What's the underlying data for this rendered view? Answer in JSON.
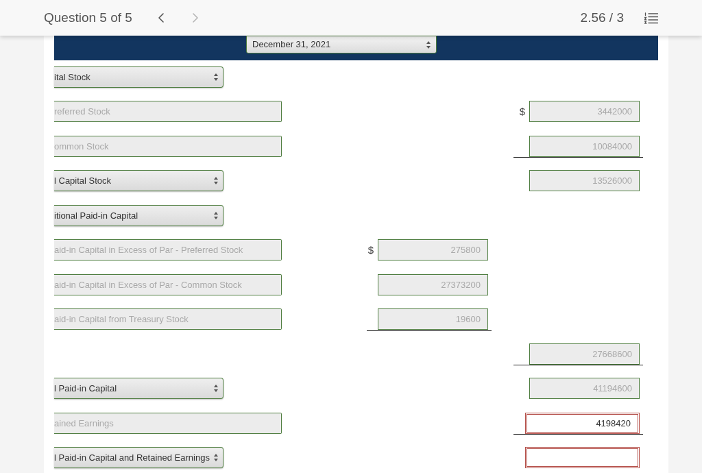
{
  "header": {
    "title": "Question 5 of 5",
    "prev_disabled": false,
    "next_disabled": true,
    "score": "2.56 / 3"
  },
  "date_select": {
    "value": "December 31, 2021"
  },
  "rows": [
    {
      "kind": "select",
      "label": "ital Stock"
    },
    {
      "kind": "text",
      "label": "referred Stock",
      "right": {
        "currency": "$",
        "value": "3442000",
        "disabled": true,
        "incorrect": false,
        "ruled": false
      }
    },
    {
      "kind": "text",
      "label": "ommon Stock",
      "right": {
        "value": "10084000",
        "disabled": true,
        "incorrect": false,
        "ruled": true
      }
    },
    {
      "kind": "select",
      "label": "l Capital Stock",
      "right": {
        "value": "13526000",
        "disabled": true,
        "incorrect": false,
        "ruled": false
      }
    },
    {
      "kind": "select",
      "label": "itional Paid-in Capital"
    },
    {
      "kind": "text",
      "label": "aid-in Capital in Excess of Par - Preferred Stock",
      "middle": {
        "currency": "$",
        "value": "275800",
        "disabled": true,
        "incorrect": false,
        "ruled": false
      }
    },
    {
      "kind": "text",
      "label": "aid-in Capital in Excess of Par - Common Stock",
      "middle": {
        "value": "27373200",
        "disabled": true,
        "incorrect": false,
        "ruled": false
      }
    },
    {
      "kind": "text",
      "label": "aid-in Capital from Treasury Stock",
      "middle": {
        "value": "19600",
        "disabled": true,
        "incorrect": false,
        "ruled": true
      }
    },
    {
      "kind": "empty",
      "right": {
        "value": "27668600",
        "disabled": true,
        "incorrect": false,
        "ruled": true
      }
    },
    {
      "kind": "select",
      "label": "l Paid-in Capital",
      "right": {
        "value": "41194600",
        "disabled": true,
        "incorrect": false,
        "ruled": false
      }
    },
    {
      "kind": "text",
      "label": "ained Earnings",
      "right": {
        "value": "4198420",
        "disabled": false,
        "incorrect": true,
        "ruled": true
      }
    },
    {
      "kind": "select",
      "label": "l Paid-in Capital and Retained Earnings",
      "right": {
        "disabled": false,
        "incorrect": true,
        "ruled": false
      }
    }
  ]
}
